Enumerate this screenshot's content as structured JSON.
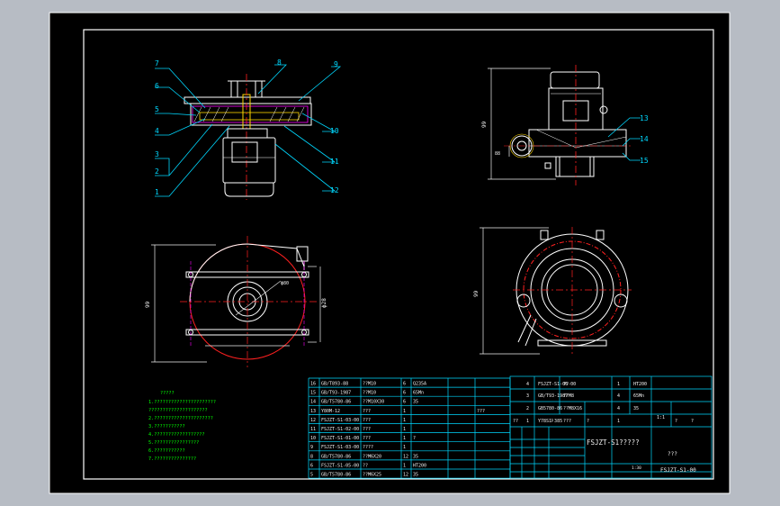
{
  "colors": {
    "viewport_bg": "#b7bcc4",
    "paper": "#000000",
    "frame": "#ffffff",
    "outline": "#ffffff",
    "leader": "#00d8ff",
    "table": "#00d8ff",
    "centerline": "#ff2020",
    "hidden": "#ff00ff",
    "dimension": "#f0f0f0",
    "notes": "#00ff00",
    "part_color": "#ffd800"
  },
  "balloons": {
    "b1": "1",
    "b2": "2",
    "b3": "3",
    "b4": "4",
    "b5": "5",
    "b6": "6",
    "b7": "7",
    "b8": "8",
    "b9": "9",
    "b10": "10",
    "b11": "11",
    "b12": "12",
    "b13": "13",
    "b14": "14",
    "b15": "15"
  },
  "dims": {
    "side_height": "99",
    "side_inlet": "88",
    "top_width": "ϕ28",
    "top_height": "99",
    "top_diam": "ϕ80",
    "bottom_height": "99"
  },
  "bom": {
    "rows": [
      {
        "no": "16",
        "code": "GB/T893-88",
        "name": "??M10",
        "qty": "6",
        "mat": "Q235A",
        "wt": "",
        "note": ""
      },
      {
        "no": "15",
        "code": "GB/T93-1987",
        "name": "??M10",
        "qty": "6",
        "mat": "65Mn",
        "wt": "",
        "note": ""
      },
      {
        "no": "14",
        "code": "GB/T5780-86",
        "name": "??M10X30",
        "qty": "6",
        "mat": "35",
        "wt": "",
        "note": ""
      },
      {
        "no": "13",
        "code": "Y80M-12",
        "name": "???",
        "qty": "1",
        "mat": "",
        "wt": "",
        "note": "???"
      },
      {
        "no": "12",
        "code": "FSJZT-S1-03-00",
        "name": "???",
        "qty": "1",
        "mat": "",
        "wt": "",
        "note": ""
      },
      {
        "no": "11",
        "code": "FSJZT-S1-02-00",
        "name": "???",
        "qty": "1",
        "mat": "",
        "wt": "",
        "note": ""
      },
      {
        "no": "10",
        "code": "FSJZT-S1-01-00",
        "name": "???",
        "qty": "1",
        "mat": "?",
        "wt": "",
        "note": ""
      },
      {
        "no": "9",
        "code": "FSJZT-S1-03-00",
        "name": "????",
        "qty": "1",
        "mat": "",
        "wt": "",
        "note": ""
      },
      {
        "no": "8",
        "code": "GB/T5780-86",
        "name": "??M6X20",
        "qty": "12",
        "mat": "35",
        "wt": "",
        "note": ""
      },
      {
        "no": "6",
        "code": "FSJZT-S1-05-00",
        "name": "??",
        "qty": "1",
        "mat": "HT200",
        "wt": "",
        "note": ""
      },
      {
        "no": "5",
        "code": "GB/T5780-86",
        "name": "??M6X25",
        "qty": "12",
        "mat": "35",
        "wt": "",
        "note": ""
      }
    ],
    "top_rows": [
      {
        "no": "4",
        "code": "FSJZT-S1-06-00",
        "name": "??",
        "qty": "1",
        "mat": "HT200",
        "note": ""
      },
      {
        "no": "3",
        "code": "GB/T93-1987",
        "name": "??M8",
        "qty": "4",
        "mat": "65Mn",
        "note": ""
      },
      {
        "no": "2",
        "code": "GB5780-86",
        "name": "??M8X16",
        "qty": "4",
        "mat": "35",
        "note": ""
      },
      {
        "no": "1",
        "code": "Y78S1-385",
        "name": "???",
        "qty": "1",
        "mat": "",
        "note": ""
      }
    ],
    "header": [
      "??",
      "?",
      "?",
      "?",
      "?",
      "??",
      "?",
      "?",
      "?",
      "??",
      "?",
      "?"
    ],
    "scale": "1:1"
  },
  "title_block": {
    "drawing_name": "FSJZT-S1?????",
    "part_name": "???",
    "drawing_no": "FSJZT-S1-00",
    "sheet": "1:30"
  },
  "notes_title": "?????",
  "notes": [
    "1.??????????????????????",
    "?????????????????????",
    "2.?????????????????????",
    "3.???????????",
    "4.??????????????????",
    "5.????????????????",
    "6.???????????",
    "7.???????????????"
  ]
}
